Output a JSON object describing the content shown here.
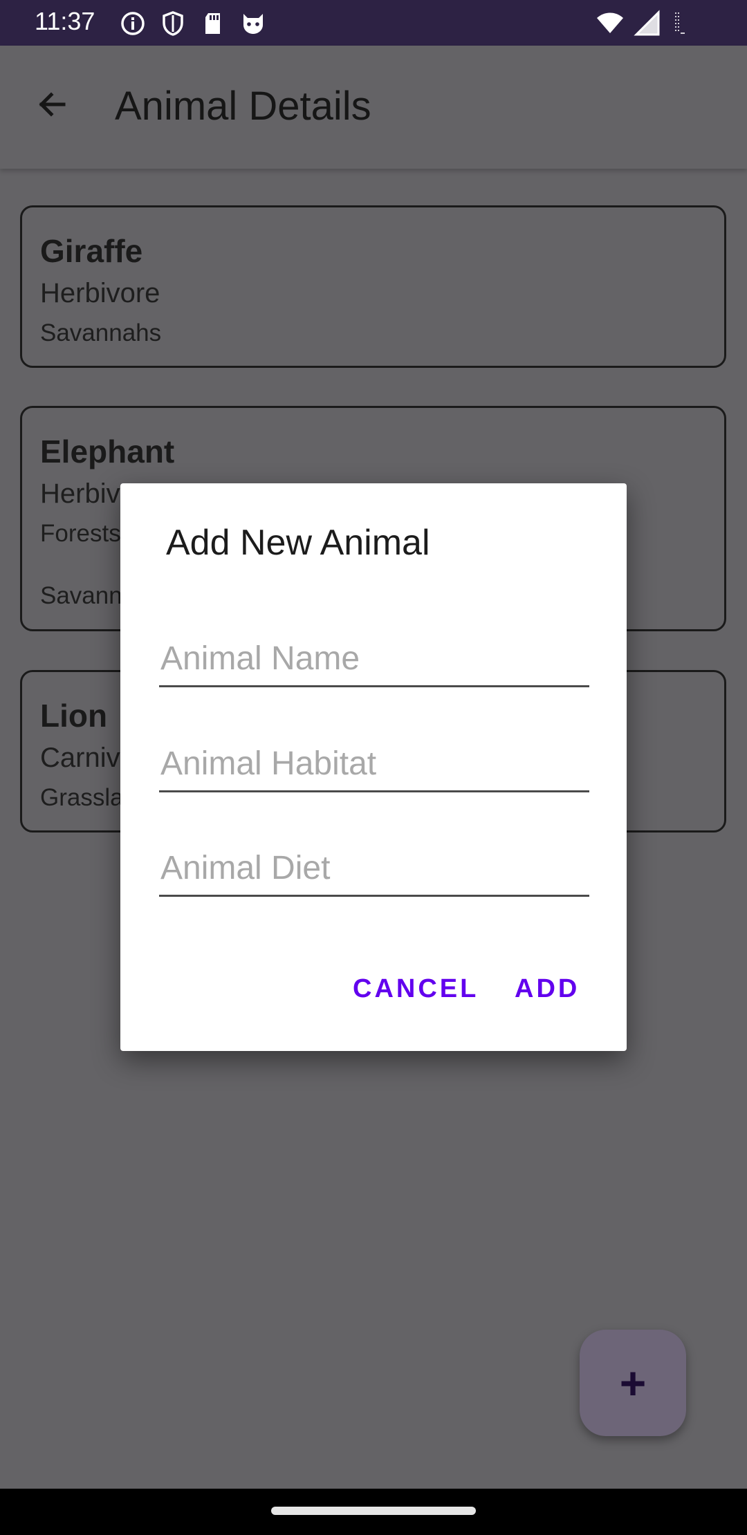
{
  "status_bar": {
    "time": "11:37",
    "left_icons": [
      "info-icon",
      "shield-icon",
      "sd-card-icon",
      "cat-face-icon"
    ],
    "right_icons": [
      "wifi-icon",
      "cell-signal-icon",
      "battery-icon"
    ]
  },
  "app_bar": {
    "back_icon": "arrow-back-icon",
    "title": "Animal Details"
  },
  "animals": [
    {
      "name": "Giraffe",
      "diet": "Herbivore",
      "habitat": "Savannahs",
      "habitat_extra": ""
    },
    {
      "name": "Elephant",
      "diet": "Herbivore",
      "habitat": "Forests",
      "habitat_extra": "Savannahs"
    },
    {
      "name": "Lion",
      "diet": "Carnivore",
      "habitat": "Grasslands",
      "habitat_extra": ""
    }
  ],
  "dialog": {
    "title": "Add New Animal",
    "name_placeholder": "Animal Name",
    "habitat_placeholder": "Animal Habitat",
    "diet_placeholder": "Animal Diet",
    "cancel_label": "CANCEL",
    "add_label": "ADD"
  },
  "fab": {
    "icon": "plus-icon",
    "label": "+"
  },
  "colors": {
    "status_bar": "#2d2244",
    "scrim_background": "#646366",
    "dialog_button": "#6200ee",
    "fab": "#6d6578"
  }
}
